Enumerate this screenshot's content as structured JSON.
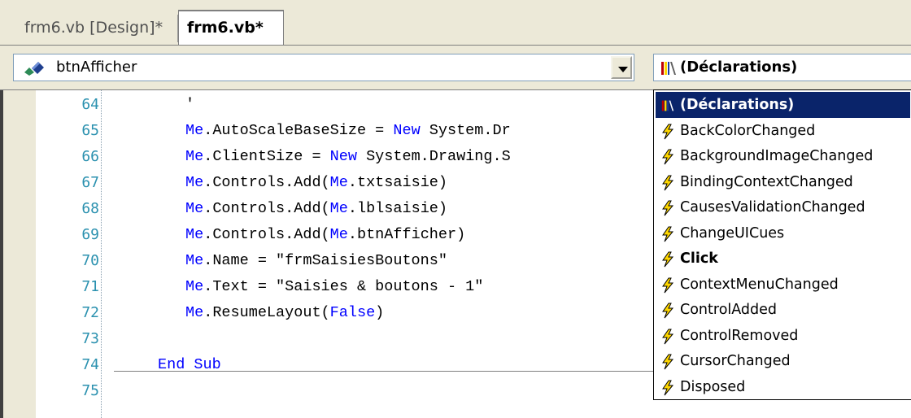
{
  "tabs": [
    {
      "label": "frm6.vb [Design]*",
      "active": false
    },
    {
      "label": "frm6.vb*",
      "active": true
    }
  ],
  "class_combo": {
    "value": "btnAfficher"
  },
  "method_combo": {
    "value": "(Déclarations)"
  },
  "code_lines": [
    {
      "num": "64",
      "text": "'"
    },
    {
      "num": "65",
      "text": "Me.AutoScaleBaseSize = New System.Dr"
    },
    {
      "num": "66",
      "text": "Me.ClientSize = New System.Drawing.S"
    },
    {
      "num": "67",
      "text": "Me.Controls.Add(Me.txtsaisie)"
    },
    {
      "num": "68",
      "text": "Me.Controls.Add(Me.lblsaisie)"
    },
    {
      "num": "69",
      "text": "Me.Controls.Add(Me.btnAfficher)"
    },
    {
      "num": "70",
      "text": "Me.Name = \"frmSaisiesBoutons\""
    },
    {
      "num": "71",
      "text": "Me.Text = \"Saisies & boutons - 1\""
    },
    {
      "num": "72",
      "text": "Me.ResumeLayout(False)"
    },
    {
      "num": "73",
      "text": ""
    },
    {
      "num": "74",
      "text": "End Sub"
    },
    {
      "num": "75",
      "text": ""
    }
  ],
  "dropdown_items": [
    {
      "label": "(Déclarations)",
      "icon": "declarations-icon",
      "state": "selected"
    },
    {
      "label": "BackColorChanged",
      "icon": "event-icon",
      "state": ""
    },
    {
      "label": "BackgroundImageChanged",
      "icon": "event-icon",
      "state": ""
    },
    {
      "label": "BindingContextChanged",
      "icon": "event-icon",
      "state": ""
    },
    {
      "label": "CausesValidationChanged",
      "icon": "event-icon",
      "state": ""
    },
    {
      "label": "ChangeUICues",
      "icon": "event-icon",
      "state": ""
    },
    {
      "label": "Click",
      "icon": "event-icon",
      "state": "bold"
    },
    {
      "label": "ContextMenuChanged",
      "icon": "event-icon",
      "state": ""
    },
    {
      "label": "ControlAdded",
      "icon": "event-icon",
      "state": ""
    },
    {
      "label": "ControlRemoved",
      "icon": "event-icon",
      "state": ""
    },
    {
      "label": "CursorChanged",
      "icon": "event-icon",
      "state": ""
    },
    {
      "label": "Disposed",
      "icon": "event-icon",
      "state": ""
    }
  ],
  "colors": {
    "keyword": "#0000ff",
    "line_number": "#2b91af",
    "selection": "#0a246a",
    "chrome": "#ece9d8",
    "event_bolt": "#ffd700"
  }
}
